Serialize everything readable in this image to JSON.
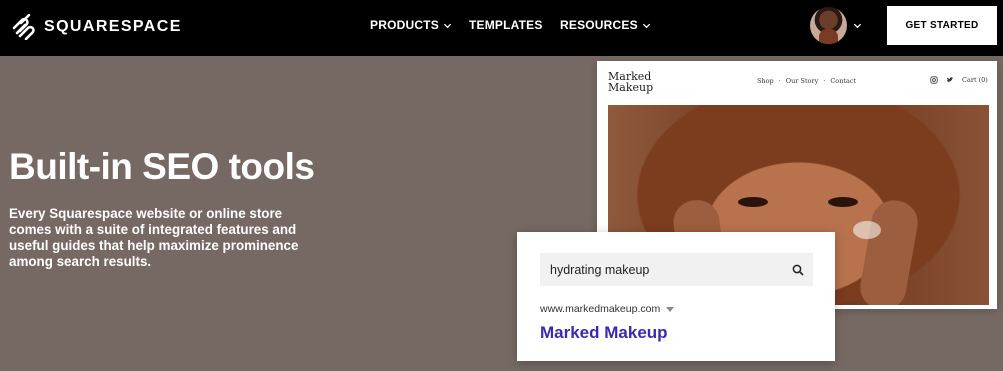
{
  "header": {
    "brand": "SQUARESPACE",
    "nav": {
      "products": "PRODUCTS",
      "templates": "TEMPLATES",
      "resources": "RESOURCES"
    },
    "cta": "GET STARTED"
  },
  "hero": {
    "title": "Built-in SEO tools",
    "description": "Every Squarespace website or online store comes with a suite of integrated features and useful guides that help maximize prominence among search results."
  },
  "preview": {
    "brand_line1": "Marked",
    "brand_line2": "Makeup",
    "links": [
      "Shop",
      "Our Story",
      "Contact"
    ],
    "cart": "Cart (0)"
  },
  "search_result": {
    "query": "hydrating makeup",
    "url": "www.markedmakeup.com",
    "title": "Marked Makeup"
  },
  "colors": {
    "background": "#766963",
    "topbar": "#000000",
    "link": "#3b2ab0"
  }
}
